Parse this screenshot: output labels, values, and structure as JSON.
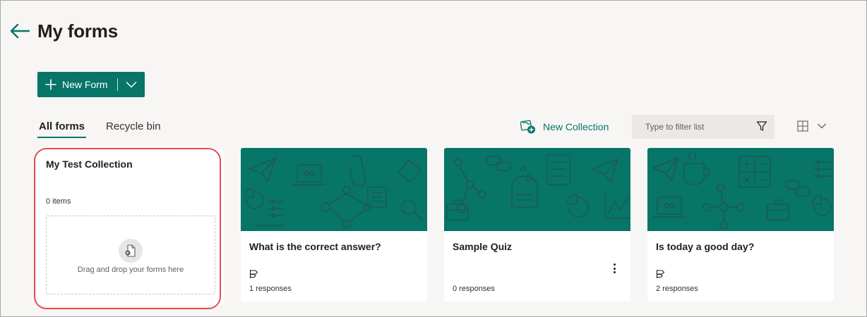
{
  "header": {
    "title": "My forms"
  },
  "toolbar": {
    "new_form_label": "New Form"
  },
  "tabs": [
    {
      "label": "All forms",
      "active": true
    },
    {
      "label": "Recycle bin",
      "active": false
    }
  ],
  "new_collection_label": "New Collection",
  "filter": {
    "placeholder": "Type to filter list",
    "value": ""
  },
  "collection": {
    "title": "My Test Collection",
    "count": "0 items",
    "drop_text": "Drag and drop your forms here"
  },
  "forms": [
    {
      "title": "What is the correct answer?",
      "responses": "1 responses",
      "icon": "quiz-icon"
    },
    {
      "title": "Sample Quiz",
      "responses": "0 responses",
      "icon": "quiz-icon"
    },
    {
      "title": "Is today a good day?",
      "responses": "2 responses",
      "icon": "quiz-icon"
    }
  ],
  "colors": {
    "accent": "#077568",
    "banner": "#077568",
    "highlight": "#e05050",
    "background": "#f7f6f5"
  },
  "icons": {
    "back": "arrow-left-icon",
    "add": "plus-icon",
    "dropdown": "chevron-down-icon",
    "collection": "collection-add-icon",
    "filter": "filter-icon",
    "view": "grid-view-icon",
    "drop": "document-drop-icon",
    "more": "more-vertical-icon"
  }
}
